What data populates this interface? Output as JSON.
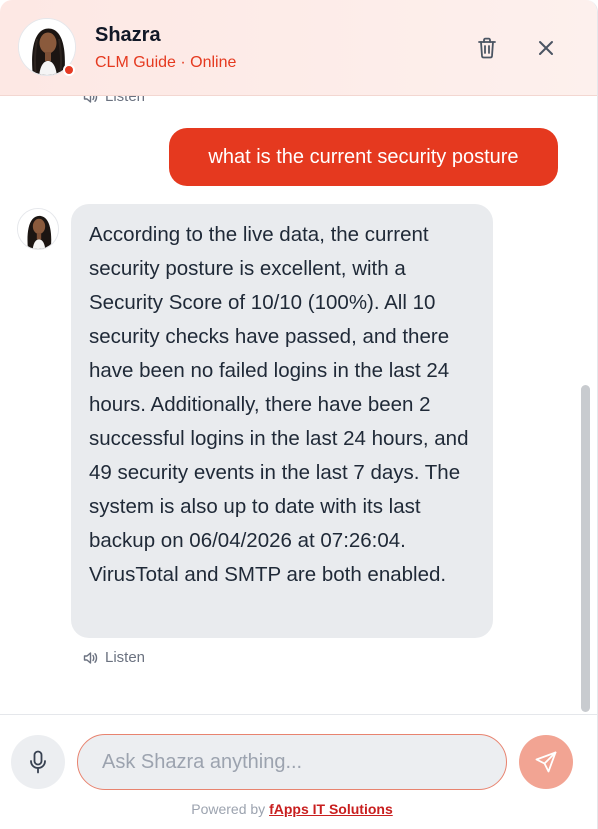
{
  "header": {
    "name": "Shazra",
    "subtitle": "CLM Guide · Online",
    "trash_icon": "trash-icon",
    "close_icon": "close-icon",
    "status_color": "#e53922"
  },
  "messages": {
    "listen_label_top": "Listen",
    "user_message": "what is the current security posture",
    "bot_message": "According to the live data, the current security posture is excellent, with a Security Score of 10/10 (100%). All 10 security checks have passed, and there have been no failed logins in the last 24 hours. Additionally, there have been 2 successful logins in the last 24 hours, and 49 security events in the last 7 days. The system is also up to date with its last backup on 06/04/2026 at 07:26:04. VirusTotal and SMTP are both enabled.",
    "listen_label": "Listen"
  },
  "composer": {
    "placeholder": "Ask Shazra anything...",
    "value": "",
    "mic_icon": "microphone-icon",
    "send_icon": "send-icon"
  },
  "footer": {
    "powered_prefix": "Powered by ",
    "powered_link": "fApps IT Solutions"
  },
  "colors": {
    "accent": "#e5391f",
    "send_button": "#f2a493",
    "bot_bubble": "#e9ebee"
  }
}
